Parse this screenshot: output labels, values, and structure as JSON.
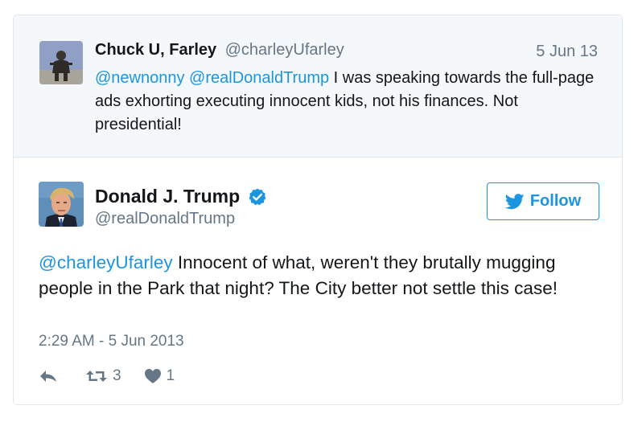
{
  "parent_tweet": {
    "author_name": "Chuck U, Farley",
    "author_handle": "@charleyUfarley",
    "date": "5 Jun 13",
    "mention_1": "@newnonny",
    "mention_2": "@realDonaldTrump",
    "text": " I was speaking towards the full-page ads exhorting executing innocent kids, not his finances. Not presidential!"
  },
  "main_tweet": {
    "author_name": "Donald J. Trump",
    "author_handle": "@realDonaldTrump",
    "verified_icon": "verified-badge-icon",
    "follow_label": "Follow",
    "mention": "@charleyUfarley",
    "text": " Innocent of what, weren't they brutally mugging people in the Park that night? The City better not settle this case!",
    "timestamp": "2:29 AM - 5 Jun 2013",
    "retweet_count": "3",
    "like_count": "1"
  },
  "colors": {
    "accent": "#1b95e0",
    "muted": "#657786",
    "text": "#14171a",
    "parent_bg": "#f5f8fa",
    "border": "#e1e8ed"
  }
}
